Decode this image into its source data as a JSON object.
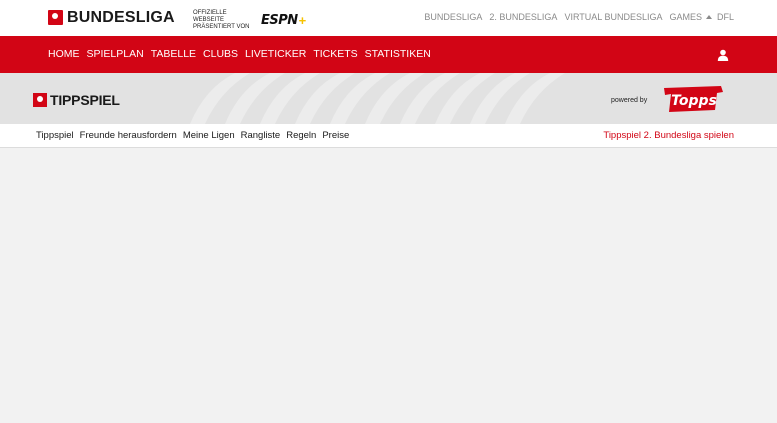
{
  "header": {
    "logo_text": "BUNDESLIGA",
    "espn_caption": "OFFIZIELLE WEBSEITE PRÄSENTIERT VON",
    "espn_logo": "ESPN",
    "espn_plus": "+",
    "links": [
      "BUNDESLIGA",
      "2. BUNDESLIGA",
      "VIRTUAL BUNDESLIGA",
      "GAMES",
      "DFL"
    ]
  },
  "nav": {
    "items": [
      "HOME",
      "SPIELPLAN",
      "TABELLE",
      "CLUBS",
      "LIVETICKER",
      "TICKETS",
      "STATISTIKEN"
    ],
    "user_icon": "user-icon"
  },
  "banner": {
    "title": "TIPPSPIEL",
    "powered_by": "powered by",
    "sponsor": "Topps"
  },
  "subnav": {
    "items": [
      "Tippspiel",
      "Freunde herausfordern",
      "Meine Ligen",
      "Rangliste",
      "Regeln",
      "Preise"
    ],
    "right_link": "Tippspiel 2. Bundesliga spielen"
  },
  "colors": {
    "brand_red": "#d20515",
    "background": "#f2f2f2"
  }
}
